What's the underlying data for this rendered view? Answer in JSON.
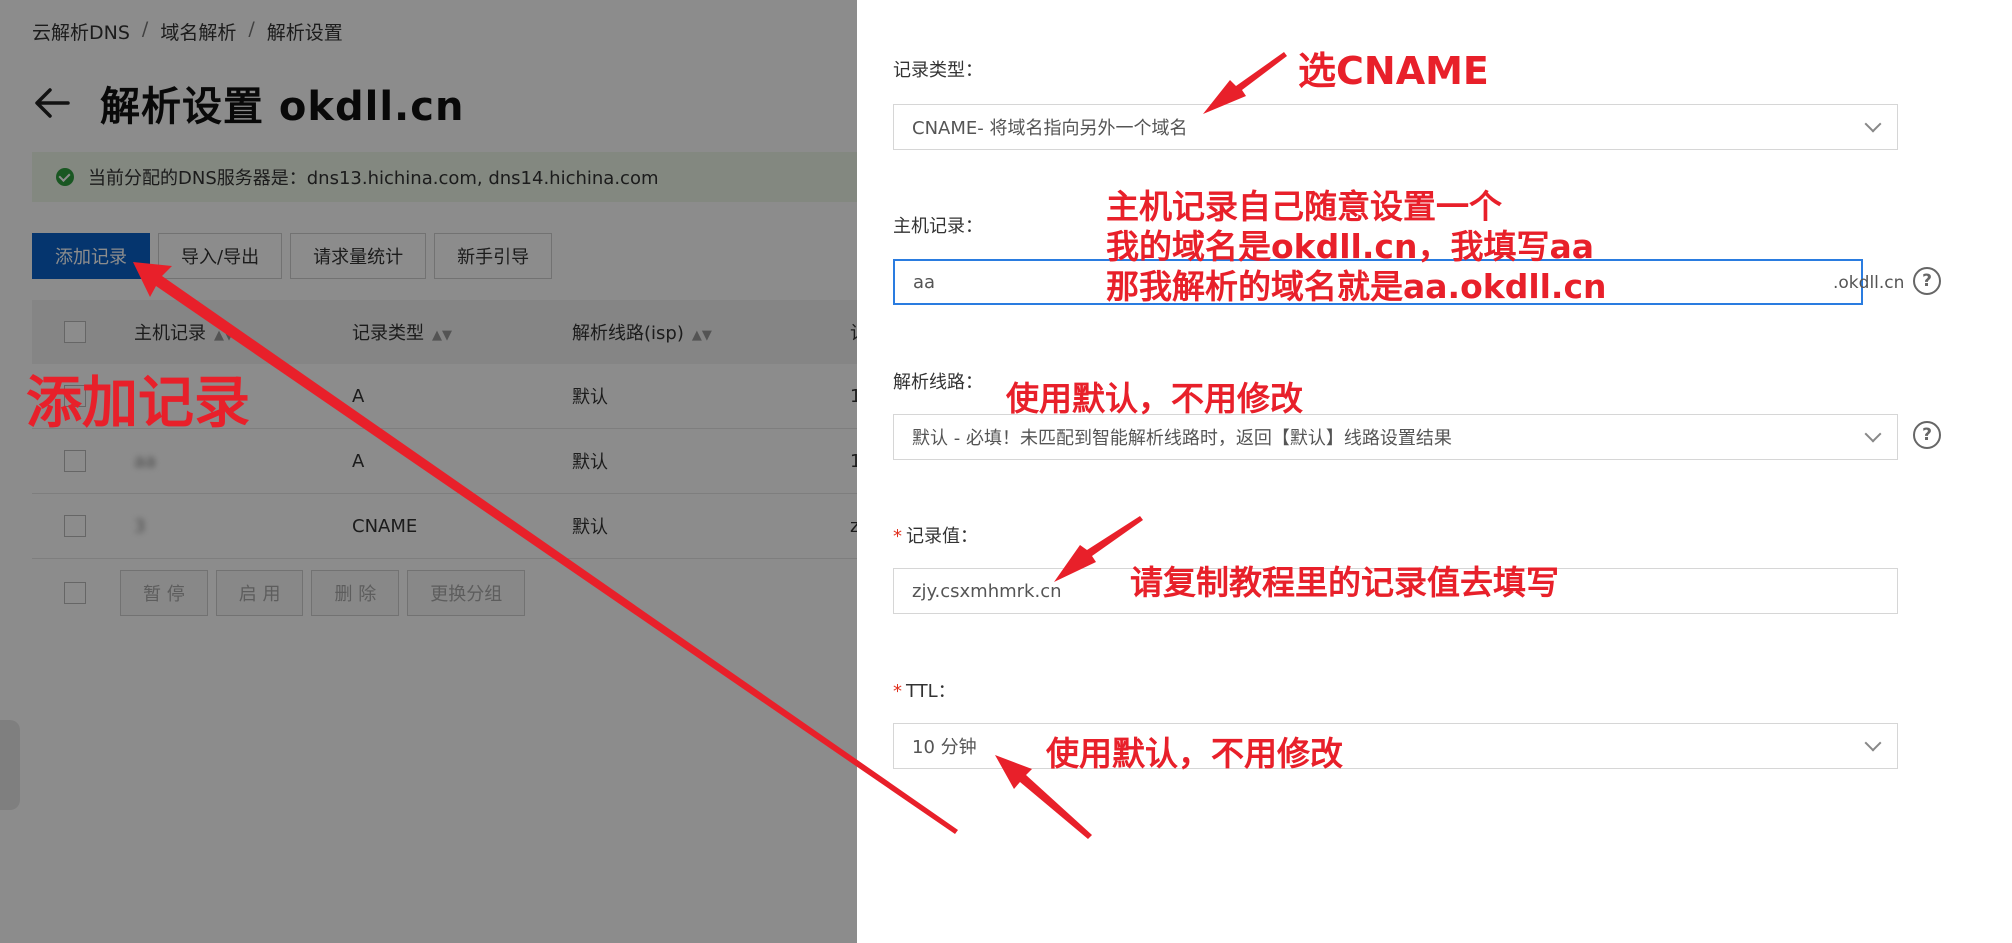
{
  "breadcrumb": {
    "items": [
      "云解析DNS",
      "域名解析",
      "解析设置"
    ],
    "separator": "/"
  },
  "header": {
    "title": "解析设置 okdll.cn"
  },
  "notice": {
    "text": "当前分配的DNS服务器是：dns13.hichina.com, dns14.hichina.com"
  },
  "toolbar": {
    "add_label": "添加记录",
    "import_label": "导入/导出",
    "stats_label": "请求量统计",
    "guide_label": "新手引导"
  },
  "table": {
    "headers": [
      "主机记录",
      "记录类型",
      "解析线路(isp)",
      "记"
    ],
    "rows": [
      {
        "host": "",
        "type": "A",
        "line": "默认",
        "value": "1"
      },
      {
        "host": "aa",
        "type": "A",
        "line": "默认",
        "value": "1"
      },
      {
        "host": "3",
        "type": "CNAME",
        "line": "默认",
        "value": "z"
      }
    ]
  },
  "bulk_actions": {
    "pause_label": "暂 停",
    "enable_label": "启 用",
    "delete_label": "删 除",
    "group_label": "更换分组"
  },
  "form": {
    "record_type": {
      "label": "记录类型：",
      "value": "CNAME- 将域名指向另外一个域名"
    },
    "host": {
      "label": "主机记录：",
      "value": "aa",
      "suffix": ".okdll.cn"
    },
    "line": {
      "label": "解析线路：",
      "value": "默认 - 必填！未匹配到智能解析线路时，返回【默认】线路设置结果"
    },
    "record_value": {
      "required": "*",
      "label": "记录值：",
      "value": "zjy.csxmhmrk.cn"
    },
    "ttl": {
      "required": "*",
      "label": "TTL：",
      "value": "10 分钟"
    },
    "help_glyph": "?"
  },
  "annotations": {
    "add_record": "添加记录",
    "select_cname": "选CNAME",
    "host_line1": "主机记录自己随意设置一个",
    "host_line2": "我的域名是okdll.cn，我填写aa",
    "host_line3": "那我解析的域名就是aa.okdll.cn",
    "line_default": "使用默认，不用修改",
    "copy_value": "请复制教程里的记录值去填写",
    "ttl_default": "使用默认，不用修改"
  },
  "colors": {
    "primary": "#0a62c9",
    "annotation": "#e8202a",
    "focus": "#2a7ce0",
    "success": "#2e9e3e",
    "required": "#e0301e"
  }
}
